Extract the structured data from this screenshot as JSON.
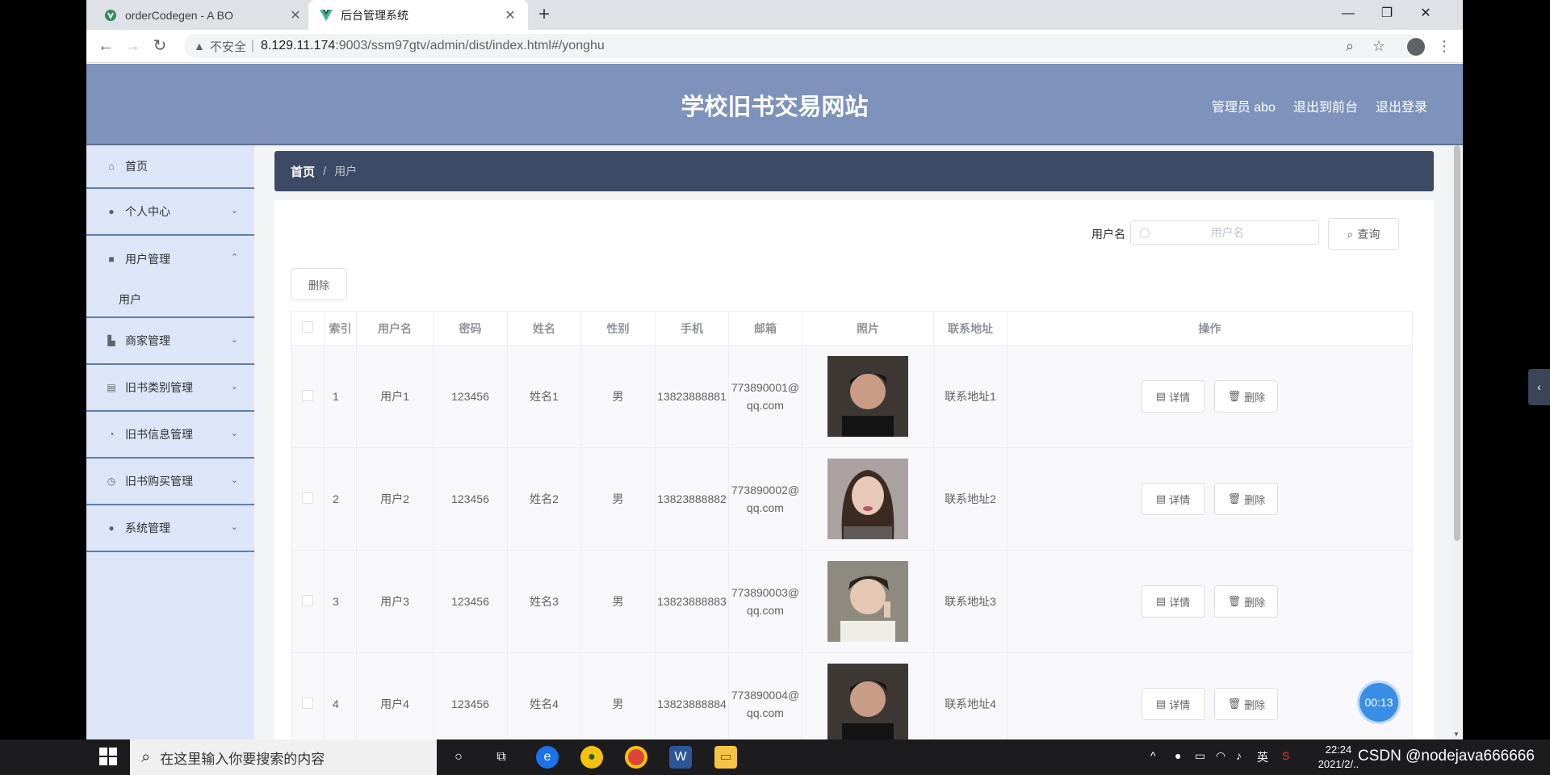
{
  "browser": {
    "tabs": [
      {
        "title": "orderCodegen - A BO",
        "active": false
      },
      {
        "title": "后台管理系统",
        "active": true
      }
    ],
    "new_tab": "+",
    "url": {
      "insecure": "不安全",
      "sep": "|",
      "host": "8.129.11.174",
      "path": ":9003/ssm97gtv/admin/dist/index.html#/yonghu"
    }
  },
  "header": {
    "title": "学校旧书交易网站",
    "links": [
      "管理员 abo",
      "退出到前台",
      "退出登录"
    ]
  },
  "sidebar": {
    "items": [
      {
        "label": "首页",
        "icon": "home-icon",
        "has_chevron": false
      },
      {
        "label": "个人中心",
        "icon": "user-icon",
        "has_chevron": true,
        "chevron": "⌄"
      },
      {
        "label": "用户管理",
        "icon": "briefcase-icon",
        "has_chevron": true,
        "chevron": "⌃"
      },
      {
        "label": "商家管理",
        "icon": "shop-icon",
        "has_chevron": true,
        "chevron": "⌄"
      },
      {
        "label": "旧书类别管理",
        "icon": "clipboard-icon",
        "has_chevron": true,
        "chevron": "⌄"
      },
      {
        "label": "旧书信息管理",
        "icon": "gauge-icon",
        "has_chevron": true,
        "chevron": "⌄"
      },
      {
        "label": "旧书购买管理",
        "icon": "clock-icon",
        "has_chevron": true,
        "chevron": "⌄"
      },
      {
        "label": "系统管理",
        "icon": "user-icon",
        "has_chevron": true,
        "chevron": "⌄"
      }
    ],
    "submenu": {
      "label": "用户"
    }
  },
  "breadcrumb": {
    "home": "首页",
    "sep": "/",
    "current": "用户"
  },
  "search": {
    "label": "用户名",
    "placeholder": "用户名",
    "button": "查询"
  },
  "actions": {
    "delete": "删除"
  },
  "table": {
    "columns": [
      "索引",
      "用户名",
      "密码",
      "姓名",
      "性别",
      "手机",
      "邮箱",
      "照片",
      "联系地址",
      "操作"
    ],
    "rows": [
      {
        "index": "1",
        "username": "用户1",
        "password": "123456",
        "name": "姓名1",
        "gender": "男",
        "phone": "13823888881",
        "email_1": "773890001@",
        "email_2": "qq.com",
        "address": "联系地址1"
      },
      {
        "index": "2",
        "username": "用户2",
        "password": "123456",
        "name": "姓名2",
        "gender": "男",
        "phone": "13823888882",
        "email_1": "773890002@",
        "email_2": "qq.com",
        "address": "联系地址2"
      },
      {
        "index": "3",
        "username": "用户3",
        "password": "123456",
        "name": "姓名3",
        "gender": "男",
        "phone": "13823888883",
        "email_1": "773890003@",
        "email_2": "qq.com",
        "address": "联系地址3"
      },
      {
        "index": "4",
        "username": "用户4",
        "password": "123456",
        "name": "姓名4",
        "gender": "男",
        "phone": "13823888884",
        "email_1": "773890004@",
        "email_2": "qq.com",
        "address": "联系地址4"
      }
    ],
    "op_detail": "详情",
    "op_delete": "删除"
  },
  "overlay": {
    "timer": "00:13",
    "side_tab": "‹"
  },
  "taskbar": {
    "search_placeholder": "在这里输入你要搜索的内容",
    "ime": "英",
    "clock_time": "22:24",
    "clock_date": "2021/2/..",
    "watermark": "CSDN @nodejava666666"
  },
  "colors": {
    "header": "#7e93bb",
    "sidebar": "#dde6f8",
    "breadcrumb": "#3d4a66",
    "accent_blue": "#3a8ee6"
  }
}
